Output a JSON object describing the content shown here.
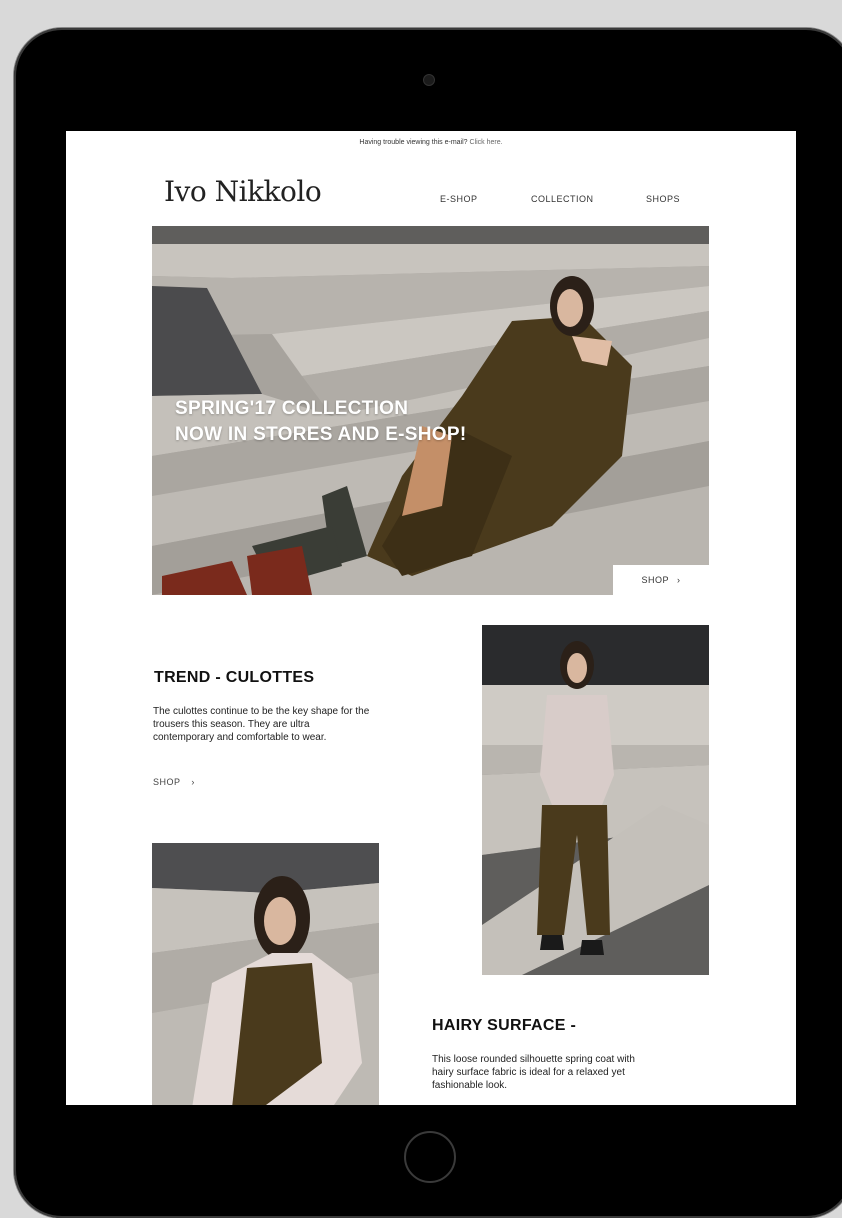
{
  "email": {
    "top_note": "Having trouble viewing this e-mail?",
    "top_note_link": "Click here.",
    "brand": "Ivo Nikkolo",
    "nav": [
      "E-SHOP",
      "COLLECTION",
      "SHOPS"
    ],
    "hero": {
      "line1": "SPRING'17 COLLECTION",
      "line2": "NOW IN STORES AND E-SHOP!",
      "shop_label": "SHOP",
      "shop_arrow": "›"
    },
    "trend": {
      "title": "TREND - CULOTTES",
      "line1": "The culottes continue to be the key shape for the",
      "line2": "trousers this season. They are ultra",
      "line3": "contemporary and comfortable to wear.",
      "shop_label": "SHOP",
      "shop_arrow": "›"
    },
    "hairy": {
      "title": "HAIRY SURFACE -",
      "line1": "This loose rounded silhouette spring coat with",
      "line2": "hairy surface fabric is ideal for a relaxed yet",
      "line3": "fashionable look."
    }
  },
  "colors": {
    "tablet_frame": "#000000",
    "background": "#d9d9d9",
    "coat_brown": "#4a3a1c",
    "stone": "#bdb9b3"
  }
}
